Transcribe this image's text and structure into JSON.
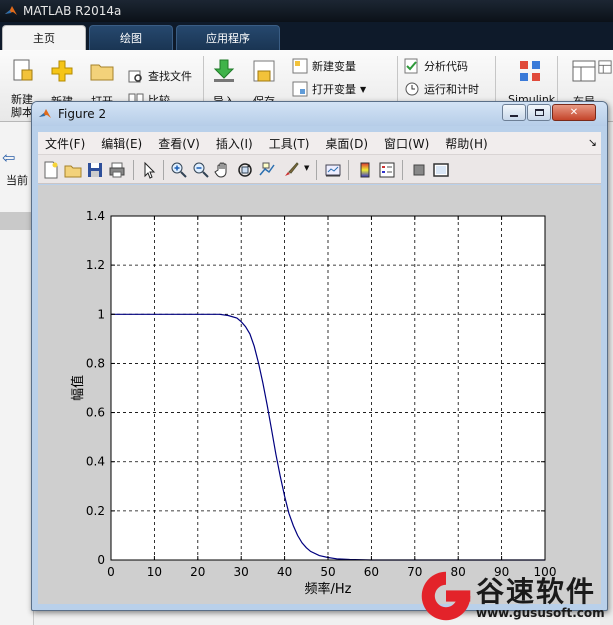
{
  "matlab": {
    "title": "MATLAB R2014a",
    "tabs": [
      {
        "label": "主页",
        "active": true
      },
      {
        "label": "绘图",
        "active": false
      },
      {
        "label": "应用程序",
        "active": false
      }
    ],
    "ribbon": {
      "new_script": "新建\n脚本",
      "new": "新建",
      "open": "打开",
      "find_files": "查找文件",
      "compare": "比较",
      "import": "导入",
      "save": "保存",
      "new_variable": "新建变量",
      "open_variable": "打开变量",
      "analyze_code": "分析代码",
      "run_and_time": "运行和计时",
      "simulink": "Simulink",
      "layout": "布局"
    },
    "left_pane": {
      "back_arrow": "⇦",
      "current_folder": "当前"
    }
  },
  "figure": {
    "title": "Figure 2",
    "menu": [
      "文件(F)",
      "编辑(E)",
      "查看(V)",
      "插入(I)",
      "工具(T)",
      "桌面(D)",
      "窗口(W)",
      "帮助(H)"
    ],
    "toolbar": [
      "new-figure",
      "open-file",
      "save",
      "print",
      "pointer",
      "zoom-in",
      "zoom-out",
      "pan",
      "rotate-3d",
      "data-cursor",
      "brush",
      "link",
      "colorbar",
      "legend",
      "hide-plot-tools",
      "show-plot-tools"
    ]
  },
  "chart_data": {
    "type": "line",
    "title": "",
    "xlabel": "频率/Hz",
    "ylabel": "幅值",
    "xlim": [
      0,
      100
    ],
    "ylim": [
      0,
      1.4
    ],
    "xticks": [
      0,
      10,
      20,
      30,
      40,
      50,
      60,
      70,
      80,
      90,
      100
    ],
    "yticks": [
      0,
      0.2,
      0.4,
      0.6,
      0.8,
      1,
      1.2,
      1.4
    ],
    "grid": true,
    "series": [
      {
        "color": "#00007f",
        "x": [
          0,
          5,
          10,
          15,
          20,
          25,
          27,
          29,
          30,
          31,
          32,
          33,
          34,
          35,
          36,
          37,
          38,
          39,
          40,
          41,
          42,
          43,
          44,
          45,
          46,
          48,
          50,
          52,
          55,
          60,
          65,
          70,
          80,
          90,
          100
        ],
        "y": [
          1,
          1,
          1,
          1,
          1,
          1,
          0.995,
          0.985,
          0.97,
          0.95,
          0.92,
          0.87,
          0.8,
          0.72,
          0.63,
          0.53,
          0.43,
          0.34,
          0.26,
          0.19,
          0.14,
          0.1,
          0.07,
          0.05,
          0.035,
          0.018,
          0.01,
          0.005,
          0.002,
          0,
          0,
          0,
          0,
          0,
          0
        ]
      }
    ]
  },
  "watermark": {
    "name": "谷速软件",
    "url": "www.gususoft.com",
    "color": "#e3232a"
  }
}
